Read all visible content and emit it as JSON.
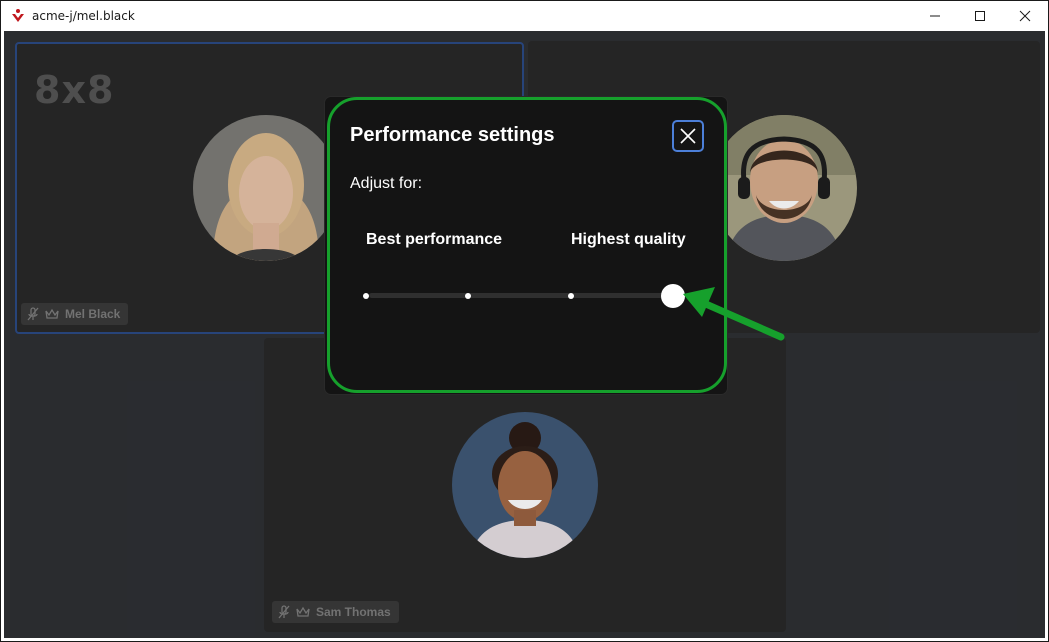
{
  "window": {
    "title": "acme-j/mel.black",
    "controls": [
      "minimize-icon",
      "maximize-icon",
      "close-icon"
    ]
  },
  "tiles": [
    {
      "name": "Mel Black",
      "logo": "8x8",
      "icons": [
        "mic-muted-icon",
        "moderator-crown-icon"
      ],
      "active_speaker": true
    },
    {
      "name": "",
      "icons": []
    },
    {
      "name": "Sam Thomas",
      "icons": [
        "mic-muted-icon",
        "moderator-crown-icon"
      ]
    }
  ],
  "dialog": {
    "title": "Performance settings",
    "close_icon": "close-icon",
    "adjust_label": "Adjust for:",
    "left_label": "Best performance",
    "right_label": "Highest quality",
    "slider": {
      "steps": 4,
      "selected_step": 4
    }
  },
  "annotation": {
    "highlight_color": "#16a02c",
    "arrow_color": "#16a02c"
  },
  "colors": {
    "active_border": "#2b4a85",
    "focus_ring": "#4c7fd8",
    "brand_red": "#c0171d"
  }
}
